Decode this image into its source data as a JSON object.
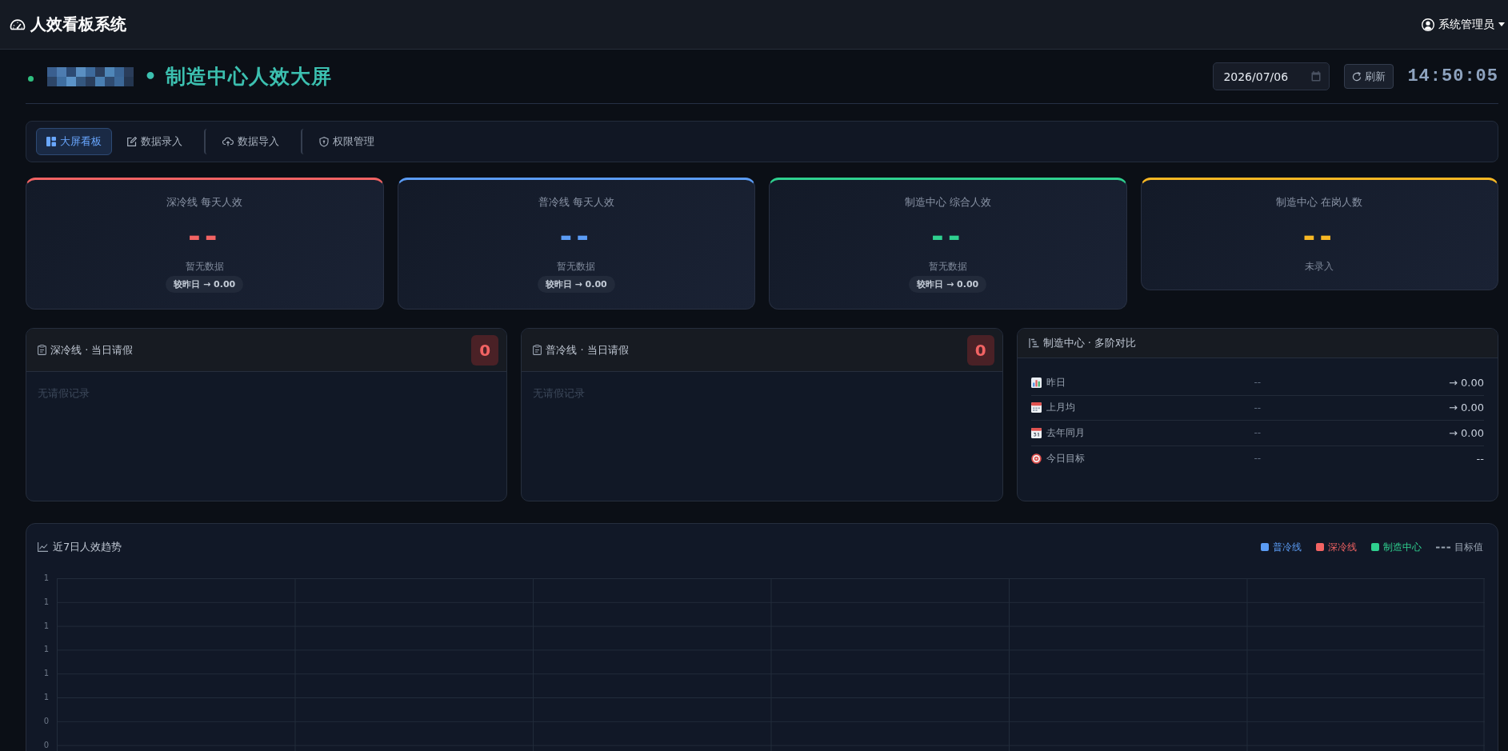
{
  "navbar": {
    "title": "人效看板系统",
    "user": "系统管理员"
  },
  "header": {
    "title": "• 制造中心人效大屏",
    "date": "2026/07/06",
    "refresh": "刷新",
    "clock": "14:50:05"
  },
  "tab_groups": [
    [
      {
        "label": "大屏看板",
        "kind": "dashboard",
        "selected": true
      },
      {
        "label": "数据录入",
        "kind": "edit",
        "selected": false
      }
    ],
    [
      {
        "label": "数据导入",
        "kind": "upload",
        "selected": false
      }
    ],
    [
      {
        "label": "权限管理",
        "kind": "shield",
        "selected": false
      }
    ]
  ],
  "kpi_cards": [
    {
      "title": "深冷线 每天人效",
      "value": "--",
      "color": "#f26363",
      "note": "暂无数据",
      "compare": "较昨日 → 0.00"
    },
    {
      "title": "普冷线 每天人效",
      "value": "--",
      "color": "#5b9cf5",
      "note": "暂无数据",
      "compare": "较昨日 → 0.00"
    },
    {
      "title": "制造中心 综合人效",
      "value": "--",
      "color": "#2fd08f",
      "note": "暂无数据",
      "compare": "较昨日 → 0.00"
    },
    {
      "title": "制造中心 在岗人数",
      "value": "--",
      "color": "#f8b824",
      "note": "未录入"
    }
  ],
  "leave_panels": [
    {
      "title": "深冷线 · 当日请假",
      "count": "0",
      "empty_text": "无请假记录"
    },
    {
      "title": "普冷线 · 当日请假",
      "count": "0",
      "empty_text": "无请假记录"
    }
  ],
  "comparison": {
    "title": "制造中心 · 多阶对比",
    "rows": [
      {
        "kind": "bar-chart",
        "label": "昨日",
        "detail": "--",
        "value": "→ 0.00"
      },
      {
        "kind": "calendar",
        "label": "上月均",
        "detail": "--",
        "value": "→ 0.00"
      },
      {
        "kind": "calendar-date",
        "label": "去年同月",
        "detail": "--",
        "value": "→ 0.00"
      },
      {
        "kind": "target",
        "label": "今日目标",
        "detail": "--",
        "value": "--"
      }
    ]
  },
  "trend_chart": {
    "title": "近7日人效趋势",
    "legend": [
      {
        "label": "普冷线",
        "kind": "swatch",
        "color": "#5b9cf5"
      },
      {
        "label": "深冷线",
        "kind": "swatch",
        "color": "#f26363"
      },
      {
        "label": "制造中心",
        "kind": "swatch",
        "color": "#2fd08f"
      },
      {
        "label": "目标值",
        "kind": "dashed",
        "color": "#9aa4b2"
      }
    ],
    "y_axis_labels": [
      "1",
      "1",
      "1",
      "1",
      "1",
      "1",
      "0",
      "0"
    ]
  }
}
